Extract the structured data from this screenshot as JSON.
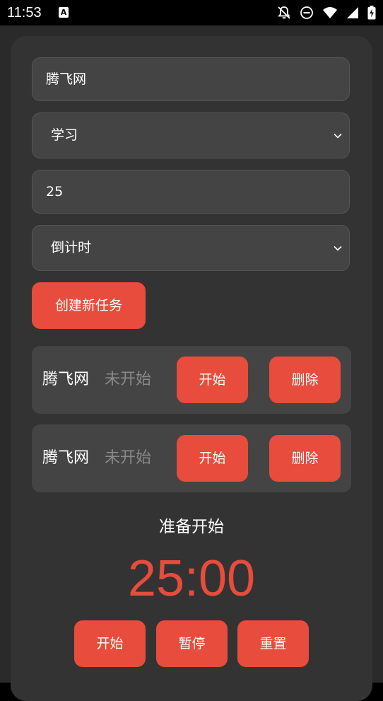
{
  "status_bar": {
    "time": "11:53",
    "notification_icon_letter": "A",
    "icons": [
      "a-notification-icon",
      "bell-off-icon",
      "do-not-disturb-icon",
      "wifi-icon",
      "signal-icon",
      "battery-charging-icon"
    ]
  },
  "form": {
    "task_name_value": "腾飞网",
    "category_selected": "学习",
    "duration_value": "25",
    "mode_selected": "倒计时",
    "create_button_label": "创建新任务"
  },
  "tasks": [
    {
      "name": "腾飞网",
      "status": "未开始",
      "start_label": "开始",
      "delete_label": "删除"
    },
    {
      "name": "腾飞网",
      "status": "未开始",
      "start_label": "开始",
      "delete_label": "删除"
    }
  ],
  "timer": {
    "label": "准备开始",
    "display": "25:00",
    "start_label": "开始",
    "pause_label": "暂停",
    "reset_label": "重置"
  },
  "colors": {
    "accent": "#e74c3c",
    "card": "#333333",
    "field": "#444444",
    "muted_text": "#8a8a8a"
  }
}
